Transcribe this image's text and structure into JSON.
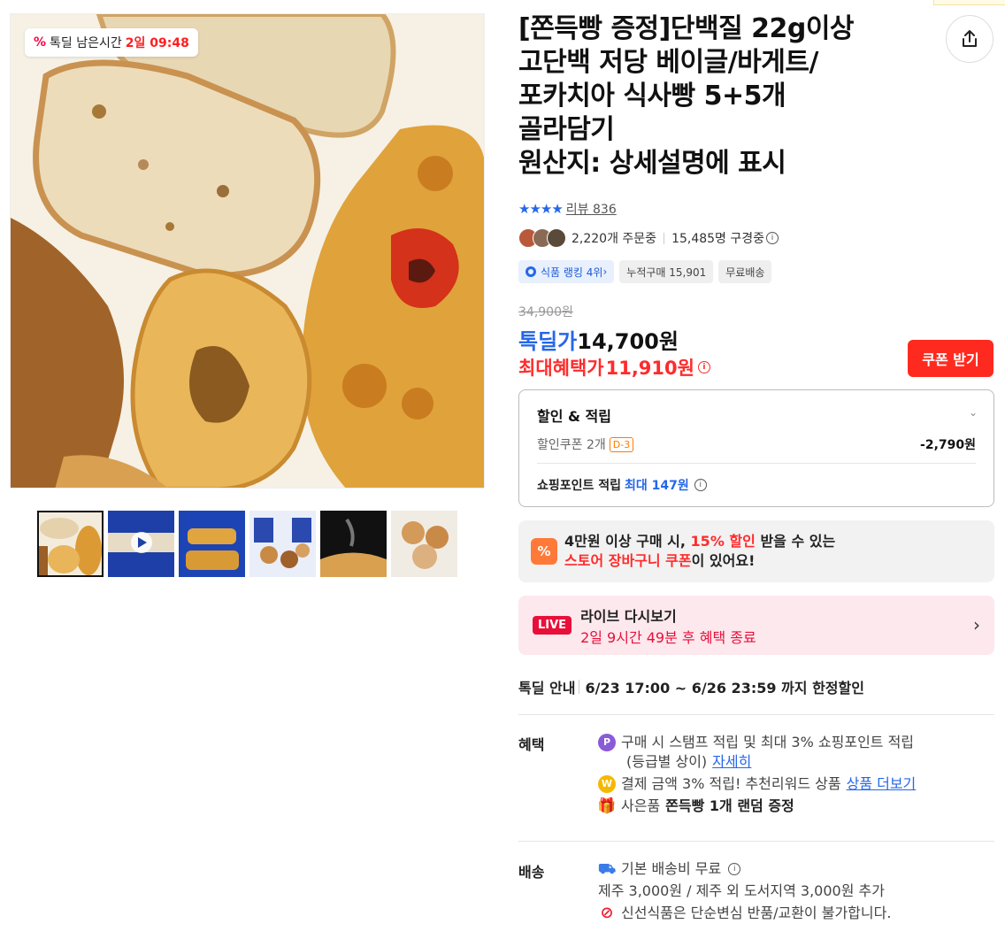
{
  "deal_timer": {
    "label": "톡딜 남은시간",
    "time": "2일 09:48"
  },
  "gallery": {
    "thumbnails": [
      {
        "name": "bread-mix",
        "selected": true
      },
      {
        "name": "video-bagel",
        "selected": false
      },
      {
        "name": "focaccia-stack",
        "selected": false
      },
      {
        "name": "bagel-packages",
        "selected": false
      },
      {
        "name": "steaming-bread",
        "selected": false
      },
      {
        "name": "bagel-plate",
        "selected": false
      }
    ]
  },
  "product": {
    "title": "[쫀득빵 증정]단백질 22g이상\n고단백 저당 베이글/바게트/\n포카치아 식사빵 5+5개\n골라담기\n원산지: 상세설명에 표시",
    "stars": "★★★★",
    "review_label": "리뷰 836",
    "ordering": "2,220개 주문중",
    "viewing": "15,485명 구경중"
  },
  "badges": {
    "rank": "식품 랭킹 4위",
    "cumulative": "누적구매 15,901",
    "free_ship": "무료배송"
  },
  "price": {
    "original": "34,900원",
    "deal_label": "톡딜가",
    "deal_value": "14,700원",
    "max_label": "최대혜택가",
    "max_value": "11,910원",
    "coupon_button": "쿠폰 받기"
  },
  "discount": {
    "head": "할인 & 적립",
    "coupon_label": "할인쿠폰 2개",
    "coupon_dday": "D-3",
    "coupon_amount": "-2,790원",
    "point_label": "쇼핑포인트 적립",
    "point_value": "최대 147원"
  },
  "store_coupon": {
    "line1_a": "4만원 이상 구매 시,",
    "line1_red": "15% 할인",
    "line1_b": "받을 수 있는",
    "line2_red": "스토어 장바구니 쿠폰",
    "line2_b": "이 있어요!"
  },
  "live": {
    "tag": "LIVE",
    "title": "라이브 다시보기",
    "subtitle": "2일 9시간 49분 후 혜택 종료"
  },
  "deal_info": {
    "label": "톡딜 안내",
    "text": "6/23 17:00 ~ 6/26 23:59 까지 한정할인"
  },
  "benefits": {
    "label": "혜택",
    "line1": "구매 시 스탬프 적립 및 최대 3% 쇼핑포인트 적립",
    "line1b": "(등급별 상이)",
    "line1_link": "자세히",
    "line2": "결제 금액 3% 적립! 추천리워드 상품",
    "line2_link": "상품 더보기",
    "line3_a": "사은품",
    "line3_b": "쫀득빵 1개 랜덤 증정"
  },
  "shipping": {
    "label": "배송",
    "line1": "기본 배송비 무료",
    "line2": "제주 3,000원 / 제주 외 도서지역 3,000원 추가",
    "line3": "신선식품은 단순변심 반품/교환이 불가합니다."
  },
  "colors": {
    "accent_blue": "#2567e8",
    "accent_red": "#ff2b2b",
    "live_red": "#e8103a"
  }
}
